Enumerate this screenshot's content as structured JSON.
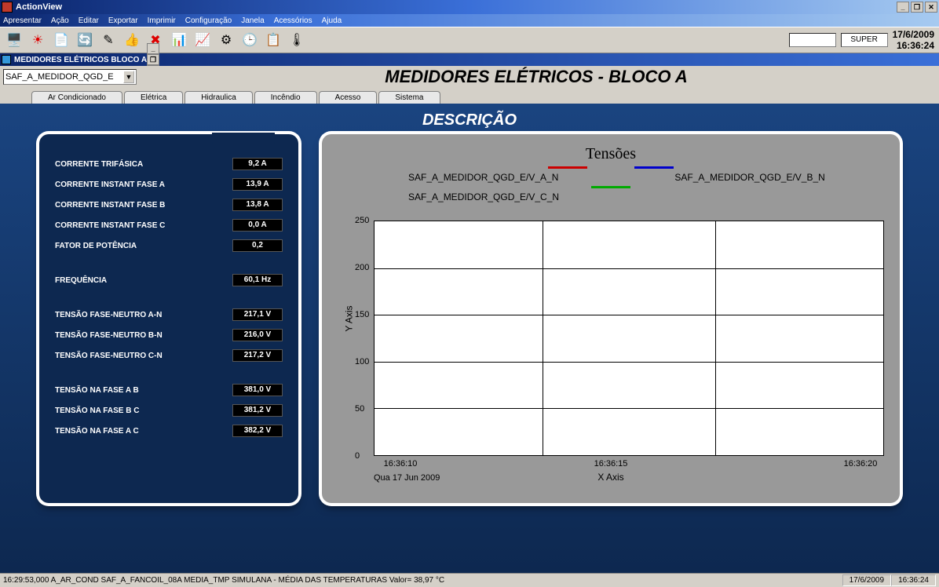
{
  "app": {
    "title": "ActionView"
  },
  "menu": [
    "Apresentar",
    "Ação",
    "Editar",
    "Exportar",
    "Imprimir",
    "Configuração",
    "Janela",
    "Acessórios",
    "Ajuda"
  ],
  "toolbar": {
    "icons": [
      "monitor-icon",
      "sun-icon",
      "page-icon",
      "refresh-icon",
      "pencil-icon",
      "thumbsup-icon",
      "cross-icon",
      "barchart-icon",
      "chart2-icon",
      "network-icon",
      "clock-icon",
      "doc-icon",
      "thermo-icon"
    ],
    "role": "SUPER",
    "date": "17/6/2009",
    "time": "16:36:24"
  },
  "subwindow": {
    "title": "MEDIDORES ELÉTRICOS  BLOCO A"
  },
  "dropdown": {
    "value": "SAF_A_MEDIDOR_QGD_E"
  },
  "page_title": "MEDIDORES ELÉTRICOS - BLOCO A",
  "tabs": [
    "Ar Condicionado",
    "Elétrica",
    "Hidraulica",
    "Incêndio",
    "Acesso",
    "Sistema"
  ],
  "section": "DESCRIÇÃO",
  "meters": [
    {
      "label": "CORRENTE TRIFÁSICA",
      "value": "9,2 A"
    },
    {
      "label": "CORRENTE INSTANT FASE A",
      "value": "13,9 A"
    },
    {
      "label": "CORRENTE INSTANT FASE B",
      "value": "13,8 A"
    },
    {
      "label": "CORRENTE INSTANT FASE C",
      "value": "0,0 A"
    },
    {
      "label": "FATOR DE POTÊNCIA",
      "value": "0,2"
    },
    {
      "label": "FREQUÊNCIA",
      "value": "60,1 Hz"
    },
    {
      "label": "TENSÃO FASE-NEUTRO A-N",
      "value": "217,1 V"
    },
    {
      "label": "TENSÃO FASE-NEUTRO B-N",
      "value": "216,0 V"
    },
    {
      "label": "TENSÃO FASE-NEUTRO C-N",
      "value": "217,2 V"
    },
    {
      "label": "TENSÃO NA FASE A B",
      "value": "381,0 V"
    },
    {
      "label": "TENSÃO NA FASE B C",
      "value": "381,2 V"
    },
    {
      "label": "TENSÃO NA FASE A C",
      "value": "382,2 V"
    }
  ],
  "chart_data": {
    "type": "line",
    "title": "Tensões",
    "xlabel": "X Axis",
    "ylabel": "Y Axis",
    "ylim": [
      0,
      250
    ],
    "yticks": [
      0,
      50,
      100,
      150,
      200,
      250
    ],
    "xticks": [
      "16:36:10",
      "16:36:15",
      "16:36:20"
    ],
    "xdate": "Qua 17 Jun 2009",
    "series": [
      {
        "name": "SAF_A_MEDIDOR_QGD_E/V_A_N",
        "color": "#cc0000",
        "values": []
      },
      {
        "name": "SAF_A_MEDIDOR_QGD_E/V_B_N",
        "color": "#0000cc",
        "values": []
      },
      {
        "name": "SAF_A_MEDIDOR_QGD_E/V_C_N",
        "color": "#00aa00",
        "values": []
      }
    ]
  },
  "statusbar": {
    "msg": "16:29:53,000 A_AR_COND SAF_A_FANCOIL_08A MEDIA_TMP SIMULANA   - MÉDIA DAS TEMPERATURAS Valor= 38,97 °C",
    "date": "17/6/2009",
    "time": "16:36:24"
  }
}
